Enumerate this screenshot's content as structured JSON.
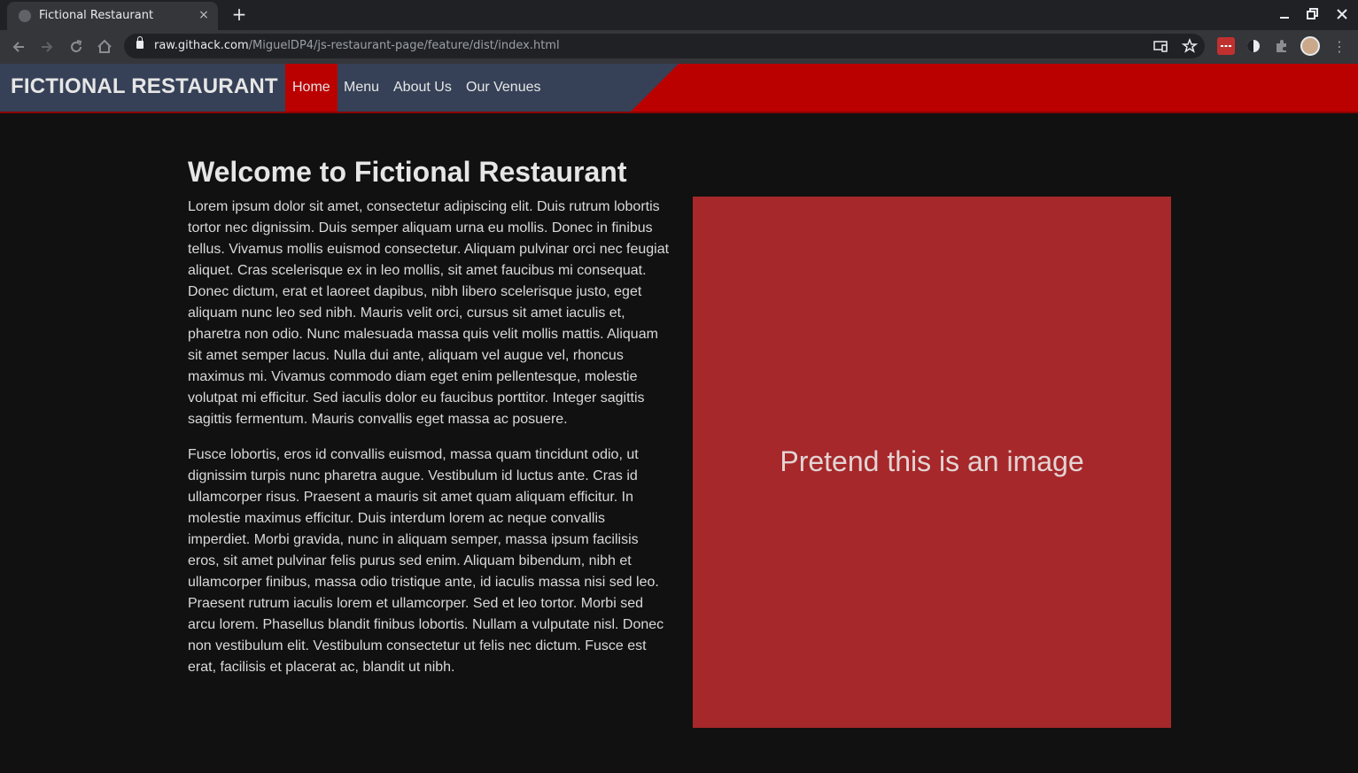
{
  "browser": {
    "tab_title": "Fictional Restaurant",
    "tab_close": "×",
    "new_tab": "+",
    "url_host": "raw.githack.com",
    "url_path": "/MiguelDP4/js-restaurant-page/feature/dist/index.html",
    "icons": [
      "back-icon",
      "forward-icon",
      "reload-icon",
      "home-icon",
      "lock-icon",
      "cast-icon",
      "star-icon",
      "extension-icon",
      "puzzle-icon",
      "avatar",
      "menu-icon"
    ]
  },
  "site": {
    "brand": "FICTIONAL RESTAURANT",
    "nav": [
      {
        "label": "Home",
        "active": true
      },
      {
        "label": "Menu",
        "active": false
      },
      {
        "label": "About Us",
        "active": false
      },
      {
        "label": "Our Venues",
        "active": false
      }
    ],
    "colors": {
      "header_slab": "#364157",
      "header_accent": "#bb0000",
      "image_box": "#a6282a",
      "background": "#111111"
    }
  },
  "main": {
    "title": "Welcome to Fictional Restaurant",
    "paragraph_1": "Lorem ipsum dolor sit amet, consectetur adipiscing elit. Duis rutrum lobortis tortor nec dignissim. Duis semper aliquam urna eu mollis. Donec in finibus tellus. Vivamus mollis euismod consectetur. Aliquam pulvinar orci nec feugiat aliquet. Cras scelerisque ex in leo mollis, sit amet faucibus mi consequat. Donec dictum, erat et laoreet dapibus, nibh libero scelerisque justo, eget aliquam nunc leo sed nibh. Mauris velit orci, cursus sit amet iaculis et, pharetra non odio. Nunc malesuada massa quis velit mollis mattis. Aliquam sit amet semper lacus. Nulla dui ante, aliquam vel augue vel, rhoncus maximus mi. Vivamus commodo diam eget enim pellentesque, molestie volutpat mi efficitur. Sed iaculis dolor eu faucibus porttitor. Integer sagittis sagittis fermentum. Mauris convallis eget massa ac posuere.",
    "paragraph_2": "Fusce lobortis, eros id convallis euismod, massa quam tincidunt odio, ut dignissim turpis nunc pharetra augue. Vestibulum id luctus ante. Cras id ullamcorper risus. Praesent a mauris sit amet quam aliquam efficitur. In molestie maximus efficitur. Duis interdum lorem ac neque convallis imperdiet. Morbi gravida, nunc in aliquam semper, massa ipsum facilisis eros, sit amet pulvinar felis purus sed enim. Aliquam bibendum, nibh et ullamcorper finibus, massa odio tristique ante, id iaculis massa nisi sed leo. Praesent rutrum iaculis lorem et ullamcorper. Sed et leo tortor. Morbi sed arcu lorem. Phasellus blandit finibus lobortis. Nullam a vulputate nisl. Donec non vestibulum elit. Vestibulum consectetur ut felis nec dictum. Fusce est erat, facilisis et placerat ac, blandit ut nibh.",
    "image_placeholder": "Pretend this is an image"
  }
}
